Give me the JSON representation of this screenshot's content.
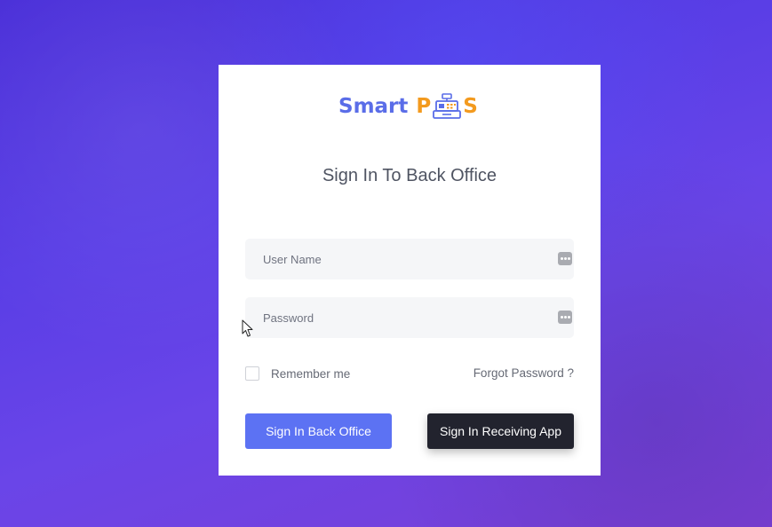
{
  "brand": {
    "part1": "Smart",
    "part2": "P",
    "part3": "S",
    "icon": "cash-register-icon",
    "color_primary": "#5a6de8",
    "color_accent": "#f39a1e"
  },
  "form": {
    "title": "Sign In To Back Office",
    "username": {
      "placeholder": "User Name",
      "value": "",
      "icon": "dots-icon"
    },
    "password": {
      "placeholder": "Password",
      "value": "",
      "icon": "dots-icon"
    },
    "remember_label": "Remember me",
    "remember_checked": false,
    "forgot_label": "Forgot Password ?"
  },
  "buttons": {
    "back_office": "Sign In Back Office",
    "receiving_app": "Sign In Receiving App"
  },
  "colors": {
    "background": "#5a3ee6",
    "primary_button": "#5c72f3",
    "dark_button": "#22232e"
  }
}
